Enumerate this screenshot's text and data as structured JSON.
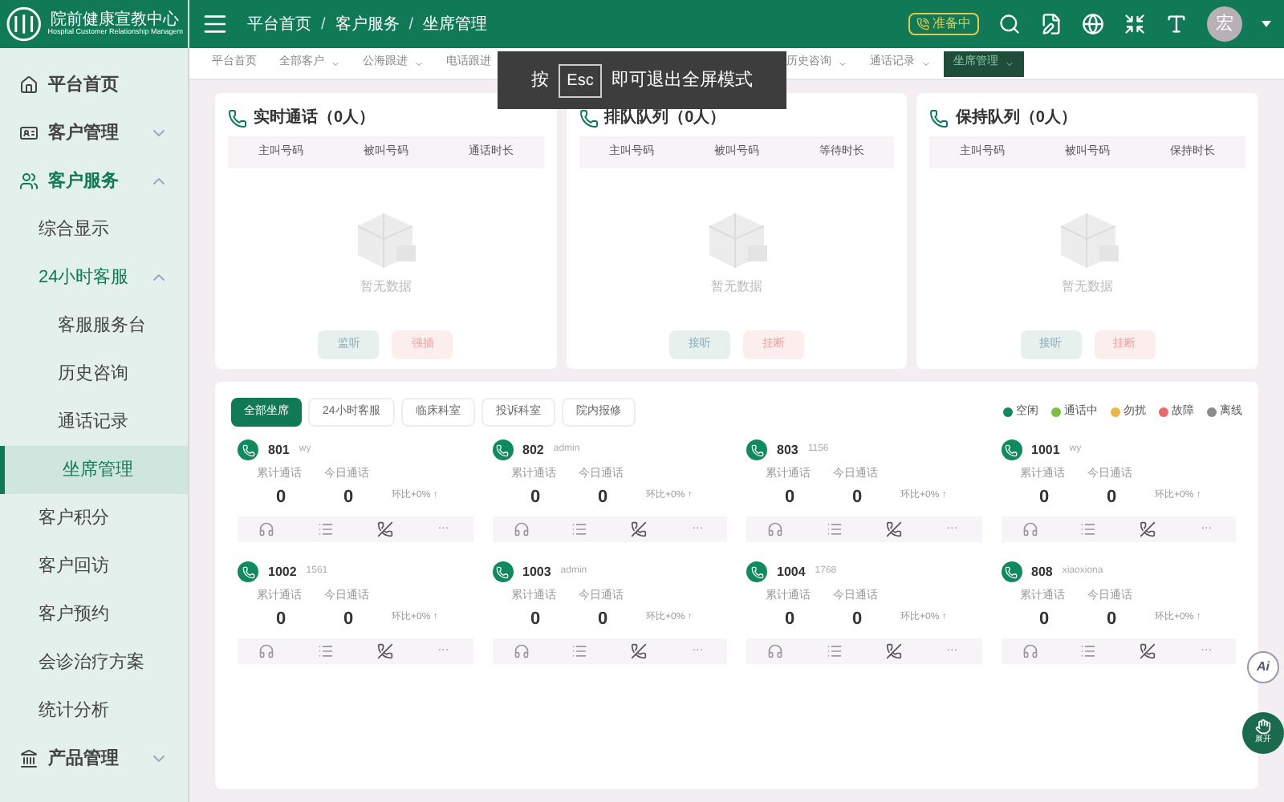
{
  "brand": {
    "title": "院前健康宣教中心",
    "subtitle": "Hospital Customer Relationship Managem"
  },
  "breadcrumb": [
    {
      "label": "平台首页"
    },
    {
      "separator": "/",
      "label": "客户服务"
    },
    {
      "separator": "/",
      "label": "坐席管理"
    }
  ],
  "header": {
    "status": "准备中",
    "avatar": "宏"
  },
  "sidebar": {
    "items": [
      {
        "label": "平台首页",
        "selected": false
      },
      {
        "label": "客户管理",
        "expanded": false,
        "selected": false
      },
      {
        "label": "客户服务",
        "expanded": true,
        "selected": false,
        "children": [
          {
            "label": "综合显示",
            "selected": false
          },
          {
            "label": "24小时客服",
            "expanded": true,
            "selected": false,
            "children": [
              {
                "label": "客服服务台",
                "selected": false
              },
              {
                "label": "历史咨询",
                "selected": false
              },
              {
                "label": "通话记录",
                "selected": false
              },
              {
                "label": "坐席管理",
                "selected": true
              }
            ]
          },
          {
            "label": "客户积分",
            "selected": false
          },
          {
            "label": "客户回访",
            "selected": false
          },
          {
            "label": "客户预约",
            "selected": false
          },
          {
            "label": "会诊治疗方案",
            "selected": false
          },
          {
            "label": "统计分析",
            "selected": false
          }
        ]
      },
      {
        "label": "产品管理",
        "expanded": false,
        "selected": false
      }
    ]
  },
  "page_tabs": [
    {
      "label": "平台首页",
      "closable": false,
      "selected": false
    },
    {
      "label": "全部客户",
      "closable": true,
      "selected": false
    },
    {
      "label": "公海跟进",
      "closable": true,
      "selected": false
    },
    {
      "label": "电话跟进",
      "closable": false,
      "selected": false
    },
    {
      "label": "历史咨询",
      "closable": true,
      "selected": false
    },
    {
      "label": "通话记录",
      "closable": true,
      "selected": false
    },
    {
      "label": "坐席管理",
      "closable": true,
      "selected": true
    }
  ],
  "fullscreen_notice": {
    "before": "按",
    "key": "Esc",
    "after": "即可退出全屏模式"
  },
  "queues": [
    {
      "title": "实时通话（0人）",
      "columns": [
        "主叫号码",
        "被叫号码",
        "通话时长"
      ],
      "empty": "暂无数据",
      "actions": [
        {
          "label": "监听",
          "kind": "primary"
        },
        {
          "label": "强插",
          "kind": "danger"
        }
      ]
    },
    {
      "title": "排队队列（0人）",
      "columns": [
        "主叫号码",
        "被叫号码",
        "等待时长"
      ],
      "empty": "暂无数据",
      "actions": [
        {
          "label": "接听",
          "kind": "primary"
        },
        {
          "label": "挂断",
          "kind": "danger"
        }
      ]
    },
    {
      "title": "保持队列（0人）",
      "columns": [
        "主叫号码",
        "被叫号码",
        "保持时长"
      ],
      "empty": "暂无数据",
      "actions": [
        {
          "label": "接听",
          "kind": "primary"
        },
        {
          "label": "挂断",
          "kind": "danger"
        }
      ]
    }
  ],
  "agent_tabs": [
    {
      "label": "全部坐席",
      "selected": true
    },
    {
      "label": "24小时客服",
      "selected": false
    },
    {
      "label": "临床科室",
      "selected": false
    },
    {
      "label": "投诉科室",
      "selected": false
    },
    {
      "label": "院内报修",
      "selected": false
    }
  ],
  "legend": [
    {
      "label": "空闲",
      "color": "#0f8a5f"
    },
    {
      "label": "通话中",
      "color": "#7ac143"
    },
    {
      "label": "勿扰",
      "color": "#e8b84a"
    },
    {
      "label": "故障",
      "color": "#e86a6a"
    },
    {
      "label": "离线",
      "color": "#8c8c8c"
    }
  ],
  "agents": [
    {
      "ext": "801",
      "user": "wy",
      "total_label": "累计通话",
      "today_label": "今日通话",
      "total": "0",
      "today": "0",
      "ratio": "环比+0% ↑",
      "color": "#0f8a5f",
      "more": "···"
    },
    {
      "ext": "802",
      "user": "admin",
      "total_label": "累计通话",
      "today_label": "今日通话",
      "total": "0",
      "today": "0",
      "ratio": "环比+0% ↑",
      "color": "#0f8a5f",
      "more": "···"
    },
    {
      "ext": "803",
      "user": "1156",
      "total_label": "累计通话",
      "today_label": "今日通话",
      "total": "0",
      "today": "0",
      "ratio": "环比+0% ↑",
      "color": "#0f8a5f",
      "more": "···"
    },
    {
      "ext": "1001",
      "user": "wy",
      "total_label": "累计通话",
      "today_label": "今日通话",
      "total": "0",
      "today": "0",
      "ratio": "环比+0% ↑",
      "color": "#0f8a5f",
      "more": "···"
    },
    {
      "ext": "1002",
      "user": "1561",
      "total_label": "累计通话",
      "today_label": "今日通话",
      "total": "0",
      "today": "0",
      "ratio": "环比+0% ↑",
      "color": "#0f8a5f",
      "more": "···"
    },
    {
      "ext": "1003",
      "user": "admin",
      "total_label": "累计通话",
      "today_label": "今日通话",
      "total": "0",
      "today": "0",
      "ratio": "环比+0% ↑",
      "color": "#0f8a5f",
      "more": "···"
    },
    {
      "ext": "1004",
      "user": "1768",
      "total_label": "累计通话",
      "today_label": "今日通话",
      "total": "0",
      "today": "0",
      "ratio": "环比+0% ↑",
      "color": "#0f8a5f",
      "more": "···"
    },
    {
      "ext": "808",
      "user": "xiaoxiona",
      "total_label": "累计通话",
      "today_label": "今日通话",
      "total": "0",
      "today": "0",
      "ratio": "环比+0% ↑",
      "color": "#0f8a5f",
      "more": "···"
    }
  ],
  "float_buttons": {
    "ai": "Ai",
    "expand": "展开"
  }
}
